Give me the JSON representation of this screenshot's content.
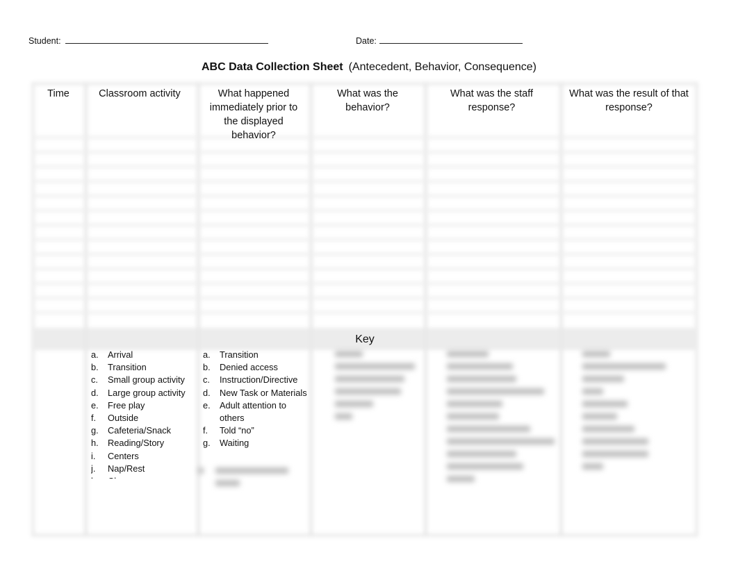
{
  "header": {
    "student_label": "Student:",
    "date_label": "Date:",
    "title_bold": "ABC Data Collection Sheet",
    "title_sub": "(Antecedent, Behavior, Consequence)"
  },
  "table": {
    "columns": [
      "Time",
      "Classroom activity",
      "What happened immediately prior to the displayed behavior?",
      "What was the behavior?",
      "What was the staff response?",
      "What was the result of that response?"
    ],
    "data_rows": 13
  },
  "key": {
    "label": "Key",
    "classroom_activities": [
      {
        "letter": "a.",
        "text": "Arrival"
      },
      {
        "letter": "b.",
        "text": "Transition"
      },
      {
        "letter": "c.",
        "text": "Small group activity"
      },
      {
        "letter": "d.",
        "text": "Large group activity"
      },
      {
        "letter": "e.",
        "text": "Free play"
      },
      {
        "letter": "f.",
        "text": "Outside"
      },
      {
        "letter": "g.",
        "text": "Cafeteria/Snack"
      },
      {
        "letter": "h.",
        "text": "Reading/Story"
      },
      {
        "letter": "i.",
        "text": "Centers"
      },
      {
        "letter": "j.",
        "text": "Nap/Rest"
      },
      {
        "letter": "k.",
        "text": "Clean up"
      }
    ],
    "antecedents": [
      {
        "letter": "a.",
        "text": "Transition"
      },
      {
        "letter": "b.",
        "text": "Denied access"
      },
      {
        "letter": "c.",
        "text": "Instruction/Directive"
      },
      {
        "letter": "d.",
        "text": "New Task or Materials"
      },
      {
        "letter": "e.",
        "text": "Adult attention to others"
      },
      {
        "letter": "f.",
        "text": "Told “no”"
      },
      {
        "letter": "g.",
        "text": "Waiting"
      }
    ]
  }
}
